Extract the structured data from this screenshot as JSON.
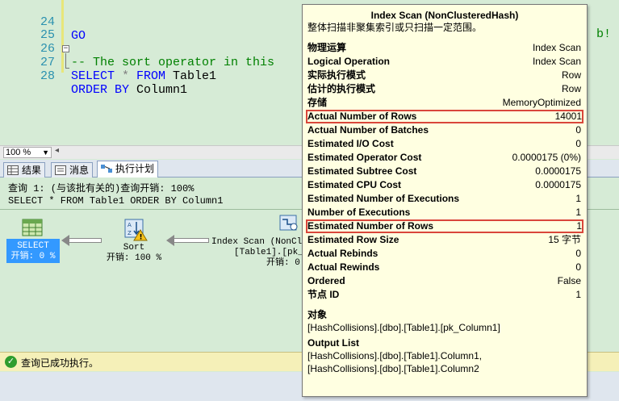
{
  "editor": {
    "lines": [
      {
        "num": "24",
        "code": "GO"
      },
      {
        "num": "26",
        "code_comment": "-- The sort operator in this"
      },
      {
        "num": "27",
        "kw1": "SELECT",
        "op": " * ",
        "kw2": "FROM",
        "tx": " Table1"
      },
      {
        "num": "28",
        "kw1": "ORDER",
        "kw2": "BY",
        "tx": " Column1"
      },
      {
        "num": "25"
      }
    ],
    "overflow_tail": "b!"
  },
  "zoom": {
    "value": "100 %"
  },
  "tabs": [
    {
      "label": "结果",
      "icon": "grid-icon",
      "active": false
    },
    {
      "label": "消息",
      "icon": "message-icon",
      "active": false
    },
    {
      "label": "执行计划",
      "icon": "plan-icon",
      "active": true
    }
  ],
  "plan": {
    "query_header": "查询 1: (与该批有关的)查询开销: 100%",
    "query_text": "SELECT * FROM Table1 ORDER BY Column1",
    "nodes": {
      "select": {
        "name": "SELECT",
        "cost": "开销: 0 %"
      },
      "sort": {
        "name": "Sort",
        "cost": "开销: 100 %"
      },
      "scan": {
        "name": "Index Scan (NonCl",
        "object": "[Table1].[pk_",
        "cost": "开销: 0"
      }
    }
  },
  "status": {
    "text": "查询已成功执行。"
  },
  "tooltip": {
    "title": "Index Scan (NonClusteredHash)",
    "description": "整体扫描非聚集索引或只扫描一定范围。",
    "rows": [
      {
        "label": "物理运算",
        "value": "Index Scan"
      },
      {
        "label": "Logical Operation",
        "value": "Index Scan"
      },
      {
        "label": "实际执行模式",
        "value": "Row"
      },
      {
        "label": "估计的执行模式",
        "value": "Row"
      },
      {
        "label": "存储",
        "value": "MemoryOptimized"
      },
      {
        "label": "Actual Number of Rows",
        "value": "14001",
        "highlight": true
      },
      {
        "label": "Actual Number of Batches",
        "value": "0"
      },
      {
        "label": "Estimated I/O Cost",
        "value": "0"
      },
      {
        "label": "Estimated Operator Cost",
        "value": "0.0000175 (0%)"
      },
      {
        "label": "Estimated Subtree Cost",
        "value": "0.0000175"
      },
      {
        "label": "Estimated CPU Cost",
        "value": "0.0000175"
      },
      {
        "label": "Estimated Number of Executions",
        "value": "1"
      },
      {
        "label": "Number of Executions",
        "value": "1"
      },
      {
        "label": "Estimated Number of Rows",
        "value": "1",
        "highlight": true
      },
      {
        "label": "Estimated Row Size",
        "value": "15 字节"
      },
      {
        "label": "Actual Rebinds",
        "value": "0"
      },
      {
        "label": "Actual Rewinds",
        "value": "0"
      },
      {
        "label": "Ordered",
        "value": "False"
      },
      {
        "label": "节点 ID",
        "value": "1"
      }
    ],
    "object_heading": "对象",
    "object_value": "[HashCollisions].[dbo].[Table1].[pk_Column1]",
    "output_heading": "Output List",
    "output_values": [
      "[HashCollisions].[dbo].[Table1].Column1,",
      "[HashCollisions].[dbo].[Table1].Column2"
    ]
  }
}
